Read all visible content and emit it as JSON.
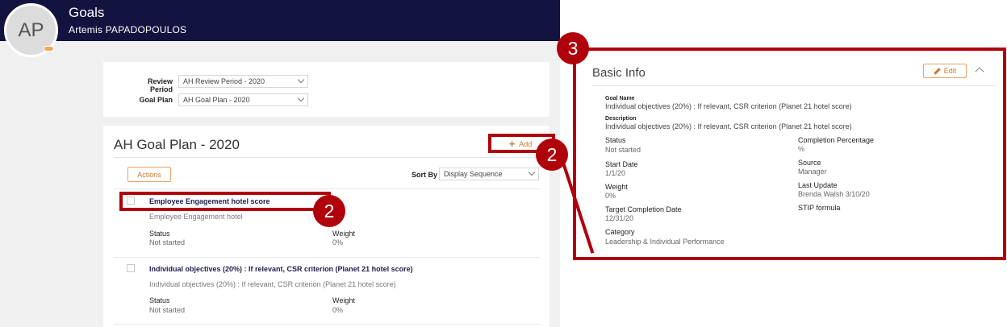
{
  "header": {
    "avatar_initials": "AP",
    "title": "Goals",
    "user_name": "Artemis PAPADOPOULOS"
  },
  "filters": {
    "review_period_label": "Review Period",
    "review_period_value": "AH Review Period - 2020",
    "goal_plan_label": "Goal Plan",
    "goal_plan_value": "AH Goal Plan - 2020"
  },
  "plan": {
    "title": "AH Goal Plan - 2020",
    "add_label": "Add",
    "actions_label": "Actions",
    "sort_by_label": "Sort By",
    "sort_by_value": "Display Sequence",
    "goals": [
      {
        "title": "Employee Engagement hotel score",
        "description": "Employee Engagement hotel",
        "status_label": "Status",
        "status_value": "Not started",
        "weight_label": "Weight",
        "weight_value": "0%"
      },
      {
        "title": "Individual objectives (20%) : If relevant, CSR criterion (Planet 21 hotel score)",
        "description": "Individual objectives (20%) : If relevant, CSR criterion (Planet 21 hotel score)",
        "status_label": "Status",
        "status_value": "Not started",
        "weight_label": "Weight",
        "weight_value": "0%"
      }
    ]
  },
  "detail": {
    "title": "Basic Info",
    "edit_label": "Edit",
    "goal_name_label": "Goal Name",
    "goal_name_value": "Individual objectives (20%) : If relevant, CSR criterion (Planet 21 hotel score)",
    "description_label": "Description",
    "description_value": "Individual objectives (20%) : If relevant, CSR criterion (Planet 21 hotel score)",
    "status_label": "Status",
    "status_value": "Not started",
    "start_date_label": "Start Date",
    "start_date_value": "1/1/20",
    "weight_label": "Weight",
    "weight_value": "0%",
    "target_date_label": "Target Completion Date",
    "target_date_value": "12/31/20",
    "category_label": "Category",
    "category_value": "Leadership & Individual Performance",
    "completion_label": "Completion Percentage",
    "completion_value": "%",
    "source_label": "Source",
    "source_value": "Manager",
    "last_update_label": "Last Update",
    "last_update_value": "Brenda Walsh 3/10/20",
    "stip_label": "STIP formula"
  },
  "callouts": {
    "badge_add": "2",
    "badge_goal": "2",
    "badge_detail": "3"
  },
  "colors": {
    "header_bg": "#13133f",
    "accent": "#c87a2c",
    "callout_red": "#b0000b"
  }
}
